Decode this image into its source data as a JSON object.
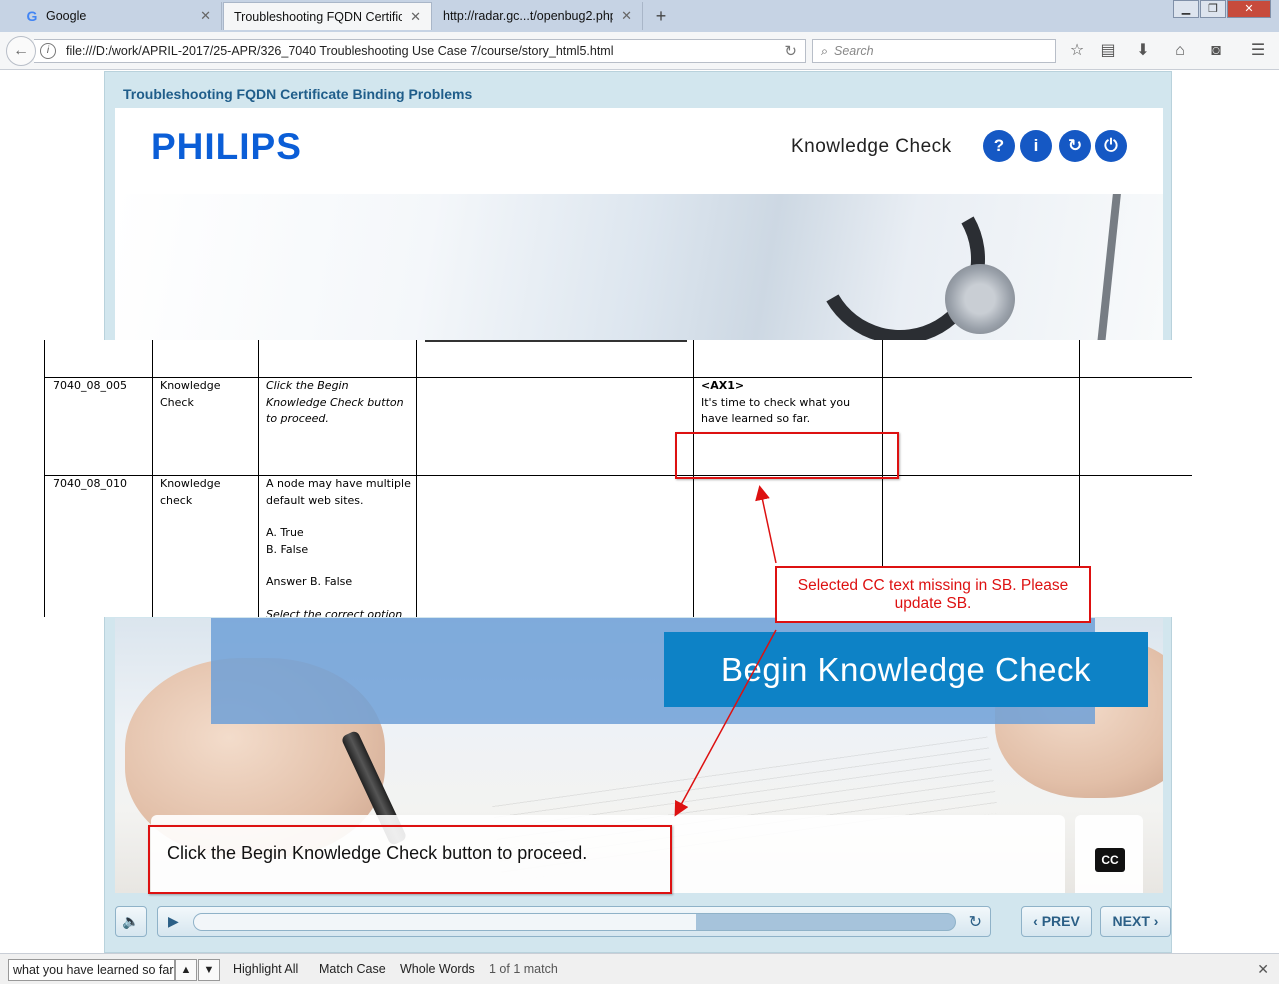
{
  "browser": {
    "tabs": [
      {
        "title": "Google",
        "favicon": "G"
      },
      {
        "title": "Troubleshooting FQDN Certific...",
        "active": true
      },
      {
        "title": "http://radar.gc...t/openbug2.php"
      }
    ],
    "url": "file:///D:/work/APRIL-2017/25-APR/326_7040 Troubleshooting Use Case 7/course/story_html5.html",
    "search_placeholder": "Search"
  },
  "course": {
    "title": "Troubleshooting FQDN Certificate Binding Problems",
    "logo": "PHILIPS",
    "section_title": "Knowledge Check",
    "header_buttons": [
      "?",
      "i",
      "↻",
      "⏻"
    ],
    "begin_button": "Begin Knowledge Check",
    "cc_text": "Click the Begin Knowledge Check button to proceed.",
    "cc_button": "CC",
    "prev_label": "PREV",
    "next_label": "NEXT",
    "progress": 0.66
  },
  "storyboard": {
    "rows": [
      {
        "id": "7040_08_005",
        "type_line1": "Knowledge",
        "type_line2": "Check",
        "onscreen_line1": "Click the Begin",
        "onscreen_line2": "Knowledge Check button",
        "onscreen_line3": "to proceed.",
        "audio_tag": "<AX1>",
        "audio_line1": "It's time to check what you",
        "audio_line2": "have learned so far."
      },
      {
        "id": "7040_08_010",
        "type_line1": "Knowledge",
        "type_line2": "check",
        "q_line1": "A node may have multiple",
        "q_line2": "default web sites.",
        "opt_a": "A. True",
        "opt_b": "B. False",
        "answer": "Answer B. False",
        "instruction": "Select the correct option"
      }
    ]
  },
  "annotation": {
    "callout_line1": "Selected CC text missing in SB. Please",
    "callout_line2": "update SB."
  },
  "findbar": {
    "query": "what you have learned so far.",
    "highlight_all": "Highlight All",
    "match_case": "Match Case",
    "whole_words": "Whole Words",
    "status": "1 of 1 match"
  },
  "colors": {
    "annotation_red": "#d11111",
    "philips_blue": "#0b5ed7",
    "begin_button": "#0d82c6"
  }
}
